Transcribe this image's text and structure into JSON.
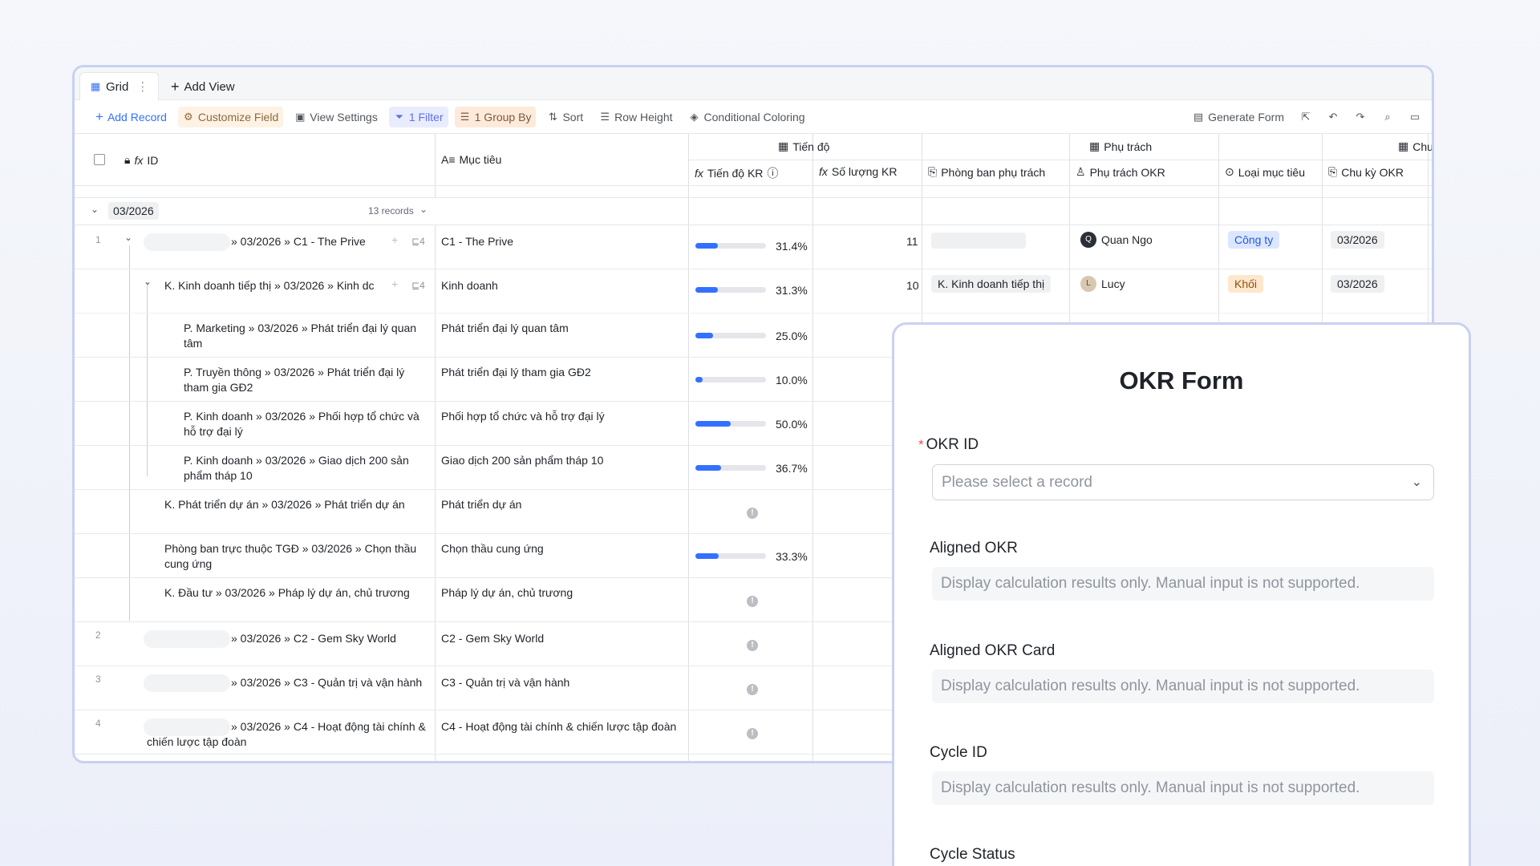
{
  "tabs": {
    "grid": "Grid",
    "add_view": "Add View"
  },
  "toolbar": {
    "add_record": "Add Record",
    "customize_field": "Customize Field",
    "view_settings": "View Settings",
    "filter": "1 Filter",
    "group_by": "1 Group By",
    "sort": "Sort",
    "row_height": "Row Height",
    "conditional_coloring": "Conditional Coloring",
    "generate_form": "Generate Form"
  },
  "columns": {
    "id": "ID",
    "muc_tieu": "Mục tiêu",
    "group_tien_do": "Tiến độ",
    "group_phu_trach": "Phụ trách",
    "group_chu": "Chu",
    "tien_do_kr": "Tiến độ KR",
    "so_luong_kr": "Số lượng KR",
    "phong_ban": "Phòng ban phụ trách",
    "phu_trach_okr": "Phụ trách OKR",
    "loai_muc_tieu": "Loại mục tiêu",
    "chu_ky_okr": "Chu kỳ OKR"
  },
  "group": {
    "label": "03/2026",
    "count": "13 records"
  },
  "rows": [
    {
      "num": "1",
      "id": "» 03/2026 » C1 - The Prive",
      "sub": "4",
      "muc_tieu": "C1 - The Prive",
      "progress": 0.314,
      "pct": "31.4%",
      "so_luong": "11",
      "phu_trach": "Quan Ngo",
      "loai": "Công ty",
      "chu_ky": "03/2026"
    },
    {
      "id": "K. Kinh doanh tiếp thị » 03/2026 » Kinh dc",
      "sub": "4",
      "muc_tieu": "Kinh doanh",
      "progress": 0.313,
      "pct": "31.3%",
      "so_luong": "10",
      "phong_ban": "K. Kinh doanh tiếp thị",
      "phu_trach": "Lucy",
      "loai": "Khối",
      "chu_ky": "03/2026"
    },
    {
      "id": "P. Marketing » 03/2026 » Phát triển đại lý quan tâm",
      "muc_tieu": "Phát triển đại lý quan tâm",
      "progress": 0.25,
      "pct": "25.0%"
    },
    {
      "id": "P. Truyền thông » 03/2026 » Phát triển đại lý tham gia GĐ2",
      "muc_tieu": "Phát triển đại lý tham gia GĐ2",
      "progress": 0.1,
      "pct": "10.0%"
    },
    {
      "id": "P. Kinh doanh » 03/2026 » Phối hợp tổ chức và hỗ trợ đại lý",
      "muc_tieu": "Phối hợp tổ chức và hỗ trợ đại lý",
      "progress": 0.5,
      "pct": "50.0%"
    },
    {
      "id": "P. Kinh doanh » 03/2026 » Giao dịch 200 sản phẩm tháp 10",
      "muc_tieu": "Giao dịch 200 sản phẩm tháp 10",
      "progress": 0.367,
      "pct": "36.7%"
    },
    {
      "id": "K. Phát triển dự án » 03/2026 » Phát triển dự án",
      "muc_tieu": "Phát triển dự án"
    },
    {
      "id": "Phòng ban trực thuộc TGĐ » 03/2026 » Chọn thầu cung ứng",
      "muc_tieu": "Chọn thầu cung ứng",
      "progress": 0.333,
      "pct": "33.3%"
    },
    {
      "id": "K. Đầu tư » 03/2026 » Pháp lý dự án, chủ trương",
      "muc_tieu": "Pháp lý dự án, chủ trương"
    },
    {
      "num": "2",
      "id": "» 03/2026 » C2 - Gem Sky World",
      "muc_tieu": "C2 - Gem Sky World"
    },
    {
      "num": "3",
      "id": "» 03/2026 » C3 - Quản trị và vận hành",
      "muc_tieu": "C3 - Quản trị và vận hành"
    },
    {
      "num": "4",
      "id": "» 03/2026 » C4 - Hoạt động tài chính & chiến lược tập đoàn",
      "muc_tieu": "C4 - Hoạt động tài chính & chiến lược tập đoàn"
    }
  ],
  "form": {
    "title": "OKR Form",
    "okr_id_label": "OKR ID",
    "okr_id_placeholder": "Please select a record",
    "aligned_okr_label": "Aligned OKR",
    "aligned_okr_card_label": "Aligned OKR Card",
    "cycle_id_label": "Cycle ID",
    "cycle_status_label": "Cycle Status",
    "readonly_text": "Display calculation results only. Manual input is not supported."
  }
}
